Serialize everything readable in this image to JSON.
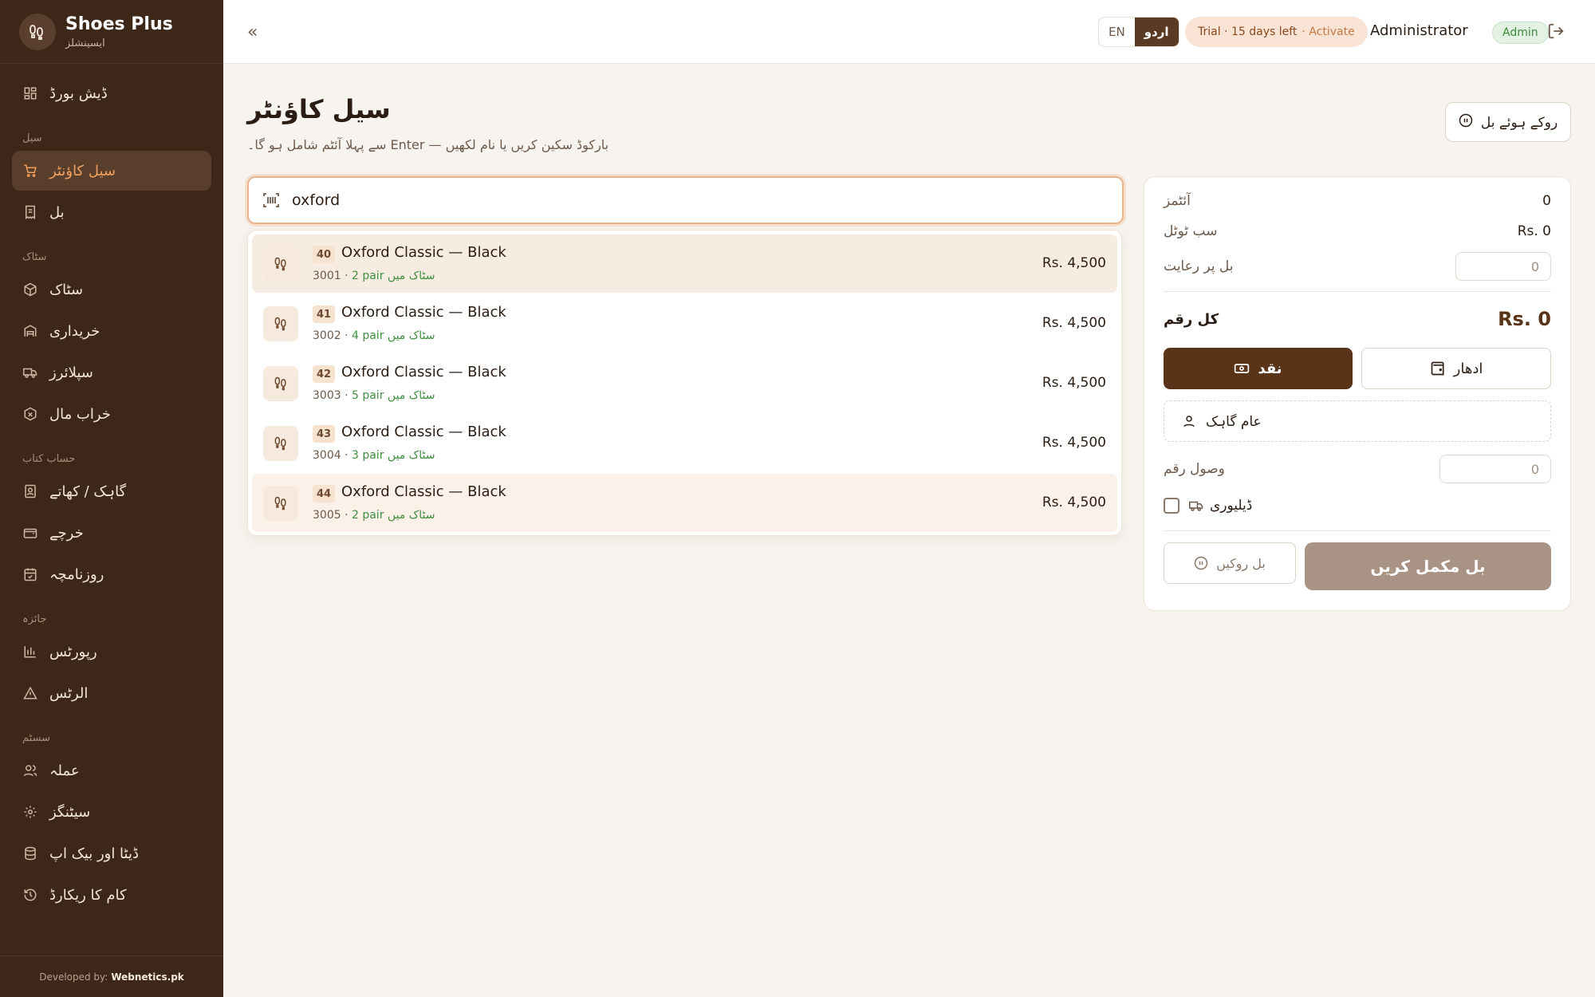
{
  "app": {
    "name": "Shoes Plus",
    "subtitle": "ایسینشلز"
  },
  "sidebar": {
    "dashboard": "ڈیش بورڈ",
    "sections": {
      "sale": "سیل",
      "stock": "سٹاک",
      "accounts": "حساب کتاب",
      "review": "جائزہ",
      "system": "سسٹم"
    },
    "items": {
      "sale_counter": "سیل کاؤنٹر",
      "bills": "بل",
      "stock": "سٹاک",
      "purchases": "خریداری",
      "suppliers": "سپلائرز",
      "damaged": "خراب مال",
      "customers": "گاہک / کھاتے",
      "expenses": "خرچے",
      "daybook": "روزنامچہ",
      "reports": "رپورٹس",
      "alerts": "الرٹس",
      "staff": "عملہ",
      "settings": "سیٹنگز",
      "backup": "ڈیٹا اور بیک اپ",
      "activity": "کام کا ریکارڈ"
    },
    "footer_prefix": "Developed by:",
    "footer_brand": "Webnetics.pk"
  },
  "topbar": {
    "lang_en": "EN",
    "lang_ur": "اردو",
    "trial_text": "Trial · 15 days left",
    "trial_action": "· Activate",
    "user_name": "Administrator",
    "role_badge": "Admin"
  },
  "page": {
    "title": "سیل کاؤنٹر",
    "subtitle": "سے پہلا آئٹم شامل ہو گا۔ Enter — بارکوڈ سکین کریں یا نام لکھیں",
    "held_bills_button": "روکے ہوئے بل"
  },
  "search": {
    "value": "oxford"
  },
  "results": [
    {
      "size": "40",
      "name": "Oxford Classic — Black",
      "code": "3001 ·",
      "stock": "2 pair سٹاک میں",
      "price": "Rs. 4,500"
    },
    {
      "size": "41",
      "name": "Oxford Classic — Black",
      "code": "3002 ·",
      "stock": "4 pair سٹاک میں",
      "price": "Rs. 4,500"
    },
    {
      "size": "42",
      "name": "Oxford Classic — Black",
      "code": "3003 ·",
      "stock": "5 pair سٹاک میں",
      "price": "Rs. 4,500"
    },
    {
      "size": "43",
      "name": "Oxford Classic — Black",
      "code": "3004 ·",
      "stock": "3 pair سٹاک میں",
      "price": "Rs. 4,500"
    },
    {
      "size": "44",
      "name": "Oxford Classic — Black",
      "code": "3005 ·",
      "stock": "2 pair سٹاک میں",
      "price": "Rs. 4,500"
    }
  ],
  "summary": {
    "items_label": "آئٹمز",
    "items_value": "0",
    "subtotal_label": "سب ٹوٹل",
    "subtotal_value": "Rs. 0",
    "discount_label": "بل پر رعایت",
    "discount_value": "0",
    "total_label": "کل رقم",
    "total_value": "Rs. 0",
    "cash_label": "نقد",
    "credit_label": "ادھار",
    "customer_label": "عام گاہک",
    "received_label": "وصول رقم",
    "received_value": "0",
    "delivery_label": "ڈیلیوری",
    "hold_label": "بل روکیں",
    "complete_label": "بل مکمل کریں"
  }
}
